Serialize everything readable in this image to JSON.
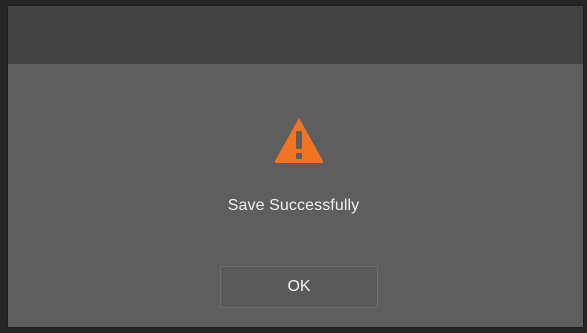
{
  "dialog": {
    "icon": "warning-triangle-icon",
    "accent_color": "#f27421",
    "message": "Save Successfully",
    "ok_label": "OK"
  }
}
